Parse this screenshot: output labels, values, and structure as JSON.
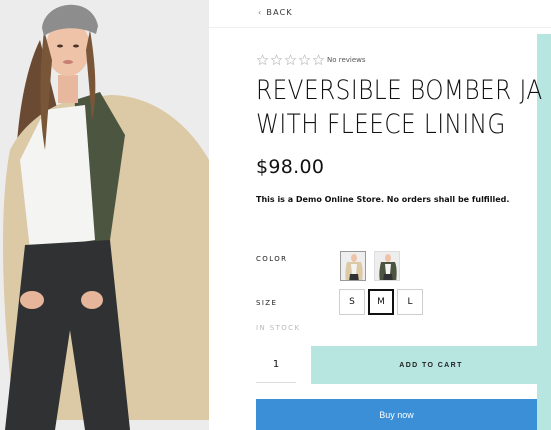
{
  "nav": {
    "back_label": "BACK"
  },
  "product": {
    "reviews_text": "No reviews",
    "rating": 0,
    "rating_max": 5,
    "title_line1": "REVERSIBLE BOMBER JA",
    "title_line2": "WITH FLEECE LINING",
    "price": "$98.00",
    "demo_note": "This is a Demo Online Store. No orders shall be fulfilled."
  },
  "options": {
    "color_label": "COLOR",
    "size_label": "SIZE",
    "sizes": [
      "S",
      "M",
      "L"
    ],
    "selected_size": "M",
    "stock_status": "IN STOCK"
  },
  "cart": {
    "quantity": "1",
    "add_to_cart_label": "ADD TO CART",
    "buy_now_label": "Buy now"
  },
  "colors": {
    "accent": "#b7e6e1",
    "buy_now": "#3b8fd6"
  }
}
